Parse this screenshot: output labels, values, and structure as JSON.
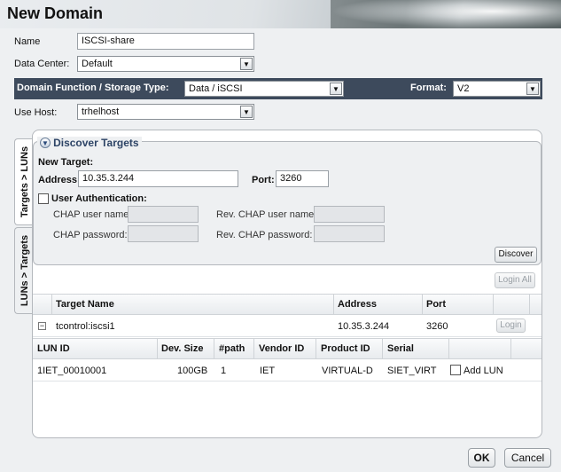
{
  "title": "New Domain",
  "form": {
    "name_label": "Name",
    "name_value": "ISCSI-share",
    "datacenter_label": "Data Center:",
    "datacenter_value": "Default",
    "function_label": "Domain Function / Storage Type:",
    "function_value": "Data  / iSCSI",
    "format_label": "Format:",
    "format_value": "V2",
    "usehost_label": "Use Host:",
    "usehost_value": "trhelhost"
  },
  "tabs": {
    "targets_luns": "Targets > LUNs",
    "luns_targets": "LUNs > Targets"
  },
  "discover": {
    "header": "Discover Targets",
    "new_target": "New Target:",
    "address_label": "Address:",
    "address_value": "10.35.3.244",
    "port_label": "Port:",
    "port_value": "3260",
    "user_auth_label": "User Authentication:",
    "chap_user_label": "CHAP user name:",
    "rev_chap_user_label": "Rev. CHAP user name:",
    "chap_pass_label": "CHAP password:",
    "rev_chap_pass_label": "Rev. CHAP password:",
    "discover_button": "Discover"
  },
  "targets": {
    "login_all": "Login All",
    "columns": [
      "Target Name",
      "Address",
      "Port"
    ],
    "row": {
      "name": "tcontrol:iscsi1",
      "address": "10.35.3.244",
      "port": "3260",
      "login": "Login"
    }
  },
  "luns": {
    "columns": [
      "LUN ID",
      "Dev. Size",
      "#path",
      "Vendor ID",
      "Product ID",
      "Serial"
    ],
    "row": {
      "lun_id": "1IET_00010001",
      "dev_size": "100GB",
      "path": "1",
      "vendor": "IET",
      "product": "VIRTUAL-D",
      "serial": "SIET_VIRT",
      "add_lun": "Add LUN"
    }
  },
  "footer": {
    "ok": "OK",
    "cancel": "Cancel"
  }
}
